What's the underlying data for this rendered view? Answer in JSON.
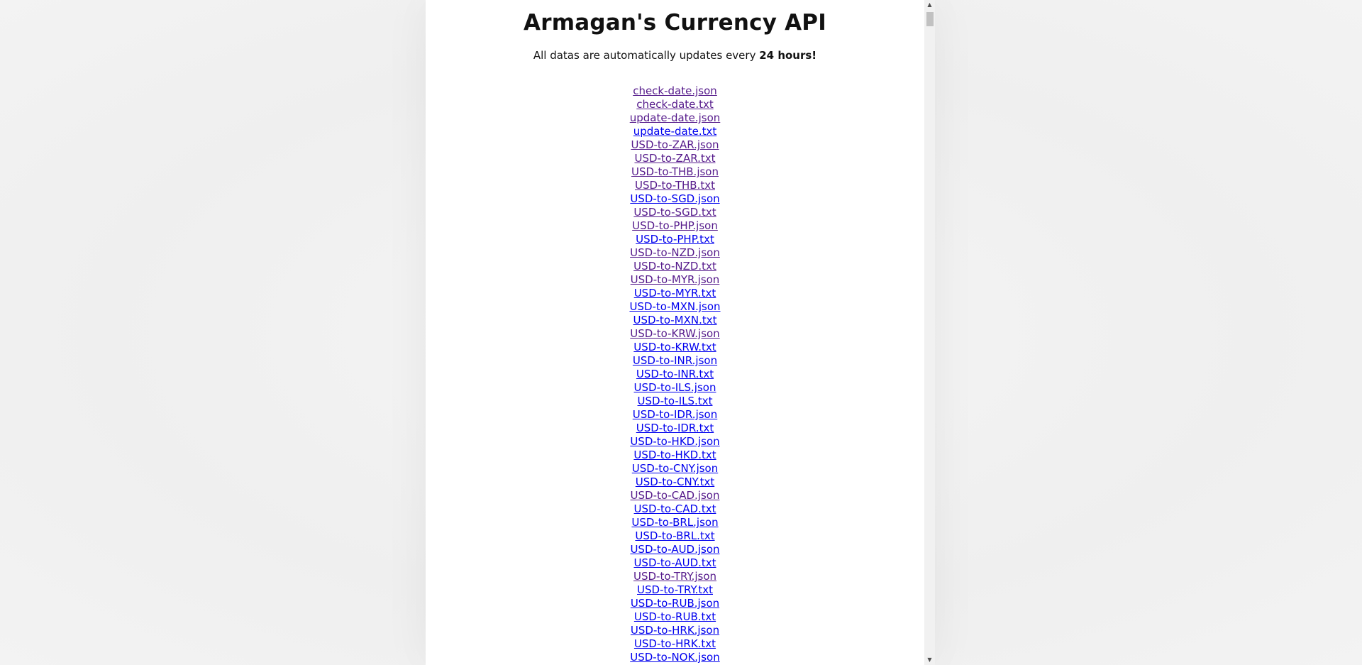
{
  "header": {
    "title": "Armagan's Currency API",
    "subtitle_prefix": "All datas are automatically updates every ",
    "subtitle_bold": "24 hours!"
  },
  "links": [
    {
      "label": "check-date.json",
      "visited": true
    },
    {
      "label": "check-date.txt",
      "visited": true
    },
    {
      "label": "update-date.json",
      "visited": true
    },
    {
      "label": "update-date.txt",
      "visited": false
    },
    {
      "label": "USD-to-ZAR.json",
      "visited": true
    },
    {
      "label": "USD-to-ZAR.txt",
      "visited": true
    },
    {
      "label": "USD-to-THB.json",
      "visited": true
    },
    {
      "label": "USD-to-THB.txt",
      "visited": true
    },
    {
      "label": "USD-to-SGD.json",
      "visited": false
    },
    {
      "label": "USD-to-SGD.txt",
      "visited": true
    },
    {
      "label": "USD-to-PHP.json",
      "visited": true
    },
    {
      "label": "USD-to-PHP.txt",
      "visited": false
    },
    {
      "label": "USD-to-NZD.json",
      "visited": true
    },
    {
      "label": "USD-to-NZD.txt",
      "visited": true
    },
    {
      "label": "USD-to-MYR.json",
      "visited": true
    },
    {
      "label": "USD-to-MYR.txt",
      "visited": false
    },
    {
      "label": "USD-to-MXN.json",
      "visited": false
    },
    {
      "label": "USD-to-MXN.txt",
      "visited": false
    },
    {
      "label": "USD-to-KRW.json",
      "visited": true
    },
    {
      "label": "USD-to-KRW.txt",
      "visited": false
    },
    {
      "label": "USD-to-INR.json",
      "visited": false
    },
    {
      "label": "USD-to-INR.txt",
      "visited": false
    },
    {
      "label": "USD-to-ILS.json",
      "visited": false
    },
    {
      "label": "USD-to-ILS.txt",
      "visited": false
    },
    {
      "label": "USD-to-IDR.json",
      "visited": false
    },
    {
      "label": "USD-to-IDR.txt",
      "visited": false
    },
    {
      "label": "USD-to-HKD.json",
      "visited": false
    },
    {
      "label": "USD-to-HKD.txt",
      "visited": false
    },
    {
      "label": "USD-to-CNY.json",
      "visited": false
    },
    {
      "label": "USD-to-CNY.txt",
      "visited": false
    },
    {
      "label": "USD-to-CAD.json",
      "visited": true
    },
    {
      "label": "USD-to-CAD.txt",
      "visited": false
    },
    {
      "label": "USD-to-BRL.json",
      "visited": false
    },
    {
      "label": "USD-to-BRL.txt",
      "visited": false
    },
    {
      "label": "USD-to-AUD.json",
      "visited": false
    },
    {
      "label": "USD-to-AUD.txt",
      "visited": false
    },
    {
      "label": "USD-to-TRY.json",
      "visited": true
    },
    {
      "label": "USD-to-TRY.txt",
      "visited": false
    },
    {
      "label": "USD-to-RUB.json",
      "visited": false
    },
    {
      "label": "USD-to-RUB.txt",
      "visited": false
    },
    {
      "label": "USD-to-HRK.json",
      "visited": false
    },
    {
      "label": "USD-to-HRK.txt",
      "visited": false
    },
    {
      "label": "USD-to-NOK.json",
      "visited": false
    }
  ],
  "colors": {
    "link": "#0000ee",
    "link_visited": "#551a8b"
  },
  "scrollbar": {
    "up_icon": "chevron-up-icon",
    "down_icon": "chevron-down-icon"
  }
}
